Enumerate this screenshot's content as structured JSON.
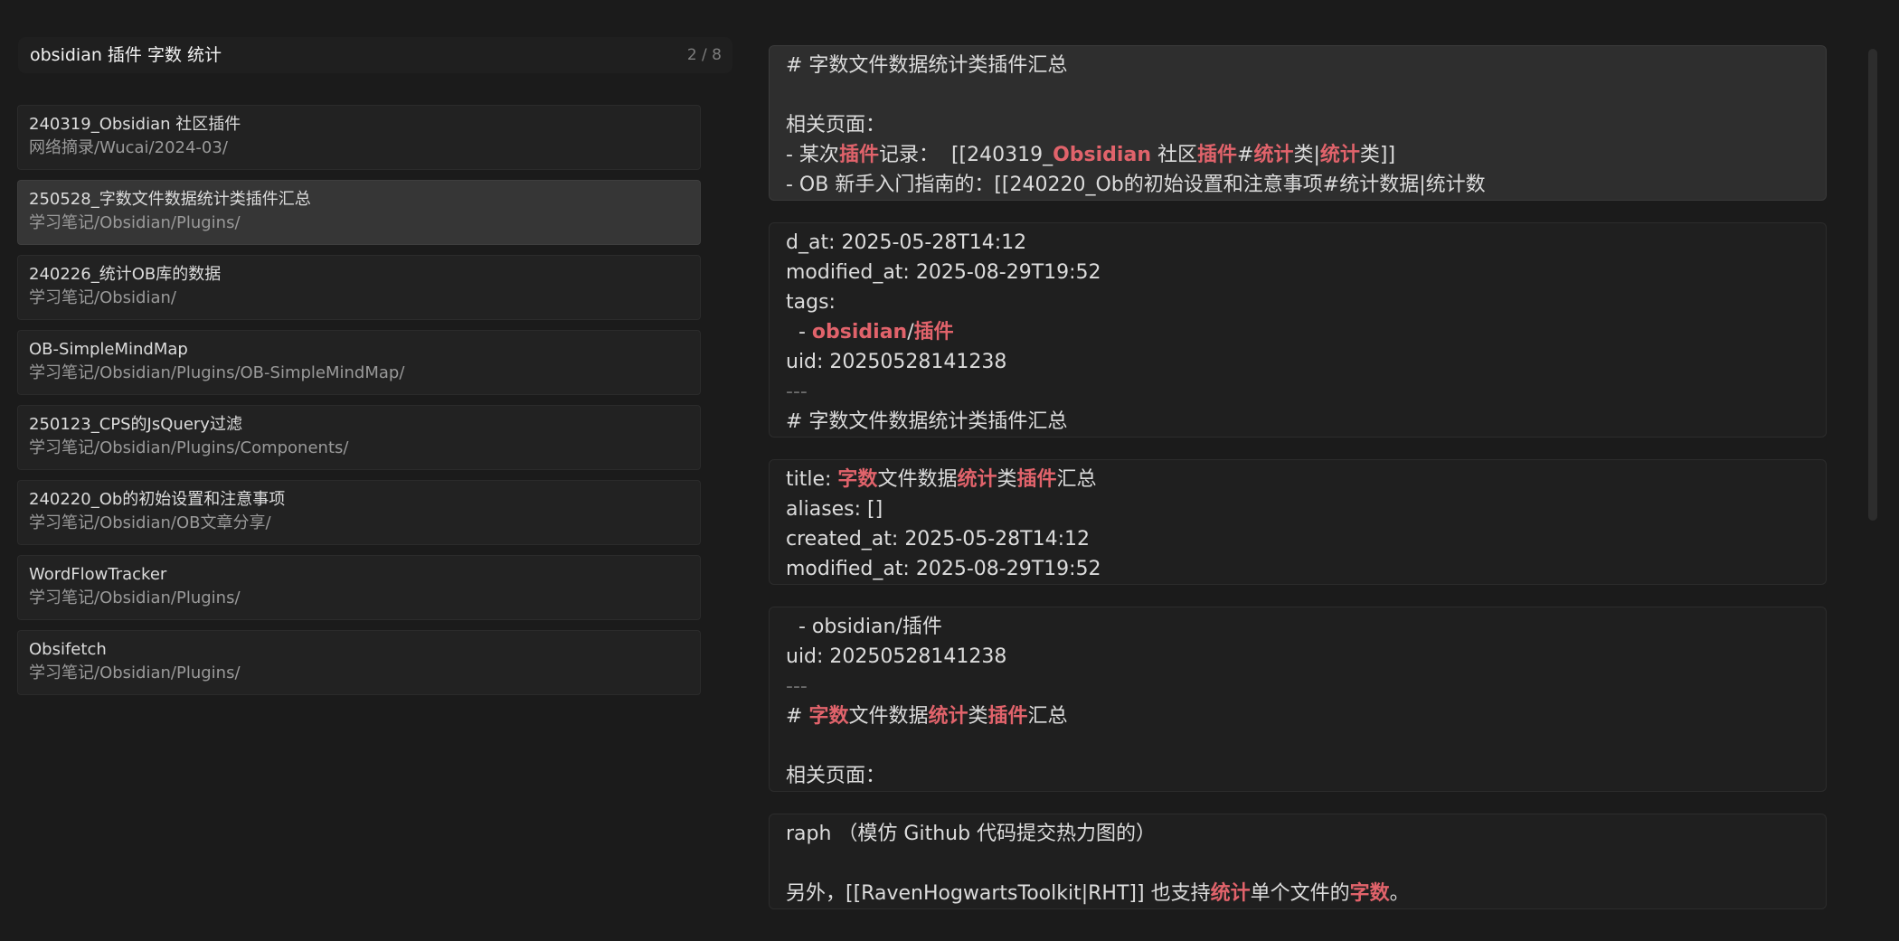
{
  "search": {
    "query": "obsidian 插件 字数 统计",
    "count": "2 / 8"
  },
  "results": [
    {
      "title": "240319_Obsidian 社区插件",
      "path": "网络摘录/Wucai/2024-03/",
      "selected": false
    },
    {
      "title": "250528_字数文件数据统计类插件汇总",
      "path": "学习笔记/Obsidian/Plugins/",
      "selected": true
    },
    {
      "title": "240226_统计OB库的数据",
      "path": "学习笔记/Obsidian/",
      "selected": false
    },
    {
      "title": "OB-SimpleMindMap",
      "path": "学习笔记/Obsidian/Plugins/OB-SimpleMindMap/",
      "selected": false
    },
    {
      "title": "250123_CPS的JsQuery过滤",
      "path": "学习笔记/Obsidian/Plugins/Components/",
      "selected": false
    },
    {
      "title": "240220_Ob的初始设置和注意事项",
      "path": "学习笔记/Obsidian/OB文章分享/",
      "selected": false
    },
    {
      "title": "WordFlowTracker",
      "path": "学习笔记/Obsidian/Plugins/",
      "selected": false
    },
    {
      "title": "Obsifetch",
      "path": "学习笔记/Obsidian/Plugins/",
      "selected": false
    }
  ],
  "colors": {
    "highlight": "#e1636b",
    "background": "#1b1b1b",
    "selected_item": "#363636"
  },
  "excerpts": [
    {
      "highlighted": true,
      "lines": [
        {
          "dim": false,
          "segments": [
            {
              "t": "# 字数文件数据统计类插件汇总"
            }
          ]
        },
        {
          "dim": false,
          "segments": [
            {
              "t": ""
            }
          ]
        },
        {
          "dim": false,
          "segments": [
            {
              "t": "相关页面："
            }
          ]
        },
        {
          "dim": false,
          "segments": [
            {
              "t": "- 某次"
            },
            {
              "t": "插件",
              "hl": true
            },
            {
              "t": "记录：  [[240319_"
            },
            {
              "t": "Obsidian",
              "hl": true
            },
            {
              "t": " 社区"
            },
            {
              "t": "插件",
              "hl": true
            },
            {
              "t": "#"
            },
            {
              "t": "统计",
              "hl": true
            },
            {
              "t": "类|"
            },
            {
              "t": "统计",
              "hl": true
            },
            {
              "t": "类]]"
            }
          ]
        },
        {
          "dim": false,
          "segments": [
            {
              "t": "- OB 新手入门指南的：[[240220_Ob的初始设置和注意事项#统计数据|统计数"
            }
          ]
        }
      ]
    },
    {
      "highlighted": false,
      "lines": [
        {
          "dim": false,
          "segments": [
            {
              "t": "d_at: 2025-05-28T14:12"
            }
          ]
        },
        {
          "dim": false,
          "segments": [
            {
              "t": "modified_at: 2025-08-29T19:52"
            }
          ]
        },
        {
          "dim": false,
          "segments": [
            {
              "t": "tags:"
            }
          ]
        },
        {
          "dim": false,
          "segments": [
            {
              "t": "  - "
            },
            {
              "t": "obsidian",
              "hl": true
            },
            {
              "t": "/"
            },
            {
              "t": "插件",
              "hl": true
            }
          ]
        },
        {
          "dim": false,
          "segments": [
            {
              "t": "uid: 20250528141238"
            }
          ]
        },
        {
          "dim": true,
          "segments": [
            {
              "t": "---"
            }
          ]
        },
        {
          "dim": false,
          "segments": [
            {
              "t": "# 字数文件数据统计类插件汇总"
            }
          ]
        }
      ]
    },
    {
      "highlighted": false,
      "lines": [
        {
          "dim": false,
          "segments": [
            {
              "t": "title: "
            },
            {
              "t": "字数",
              "hl": true
            },
            {
              "t": "文件数据"
            },
            {
              "t": "统计",
              "hl": true
            },
            {
              "t": "类"
            },
            {
              "t": "插件",
              "hl": true
            },
            {
              "t": "汇总"
            }
          ]
        },
        {
          "dim": false,
          "segments": [
            {
              "t": "aliases: []"
            }
          ]
        },
        {
          "dim": false,
          "segments": [
            {
              "t": "created_at: 2025-05-28T14:12"
            }
          ]
        },
        {
          "dim": false,
          "segments": [
            {
              "t": "modified_at: 2025-08-29T19:52"
            }
          ]
        }
      ]
    },
    {
      "highlighted": false,
      "lines": [
        {
          "dim": false,
          "segments": [
            {
              "t": "  - obsidian/插件"
            }
          ]
        },
        {
          "dim": false,
          "segments": [
            {
              "t": "uid: 20250528141238"
            }
          ]
        },
        {
          "dim": true,
          "segments": [
            {
              "t": "---"
            }
          ]
        },
        {
          "dim": false,
          "segments": [
            {
              "t": "# "
            },
            {
              "t": "字数",
              "hl": true
            },
            {
              "t": "文件数据"
            },
            {
              "t": "统计",
              "hl": true
            },
            {
              "t": "类"
            },
            {
              "t": "插件",
              "hl": true
            },
            {
              "t": "汇总"
            }
          ]
        },
        {
          "dim": false,
          "segments": [
            {
              "t": ""
            }
          ]
        },
        {
          "dim": false,
          "segments": [
            {
              "t": "相关页面："
            }
          ]
        }
      ]
    },
    {
      "highlighted": false,
      "lines": [
        {
          "dim": false,
          "segments": [
            {
              "t": "raph （模仿 Github 代码提交热力图的）"
            }
          ]
        },
        {
          "dim": false,
          "segments": [
            {
              "t": ""
            }
          ]
        },
        {
          "dim": false,
          "segments": [
            {
              "t": "另外，[[RavenHogwartsToolkit|RHT]] 也支持"
            },
            {
              "t": "统计",
              "hl": true
            },
            {
              "t": "单个文件的"
            },
            {
              "t": "字数",
              "hl": true
            },
            {
              "t": "。"
            }
          ]
        }
      ]
    }
  ]
}
